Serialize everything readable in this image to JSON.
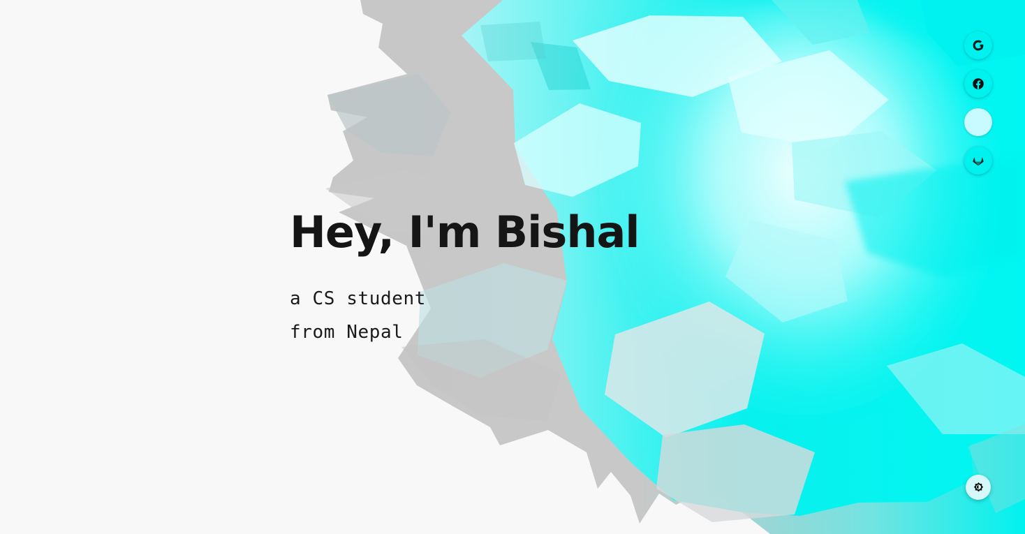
{
  "hero": {
    "title": "Hey, I'm Bishal",
    "subtitle_line_1": "a CS student",
    "subtitle_line_2": "from Nepal"
  },
  "social": {
    "items": [
      {
        "icon": "google-icon",
        "fill": "#00f2ef"
      },
      {
        "icon": "facebook-icon",
        "fill": "#00f2ef"
      },
      {
        "icon": "",
        "fill": "#c8fbff"
      },
      {
        "icon": "gitlab-icon",
        "fill": "#00f2ef"
      }
    ]
  },
  "theme": {
    "icon": "theme-toggle-icon"
  },
  "colors": {
    "background": "#f8f8f8",
    "accent": "#00f2ef",
    "accent_light": "#c8fbff",
    "text": "#151515",
    "cloud_gray": "#c7c7c7"
  }
}
